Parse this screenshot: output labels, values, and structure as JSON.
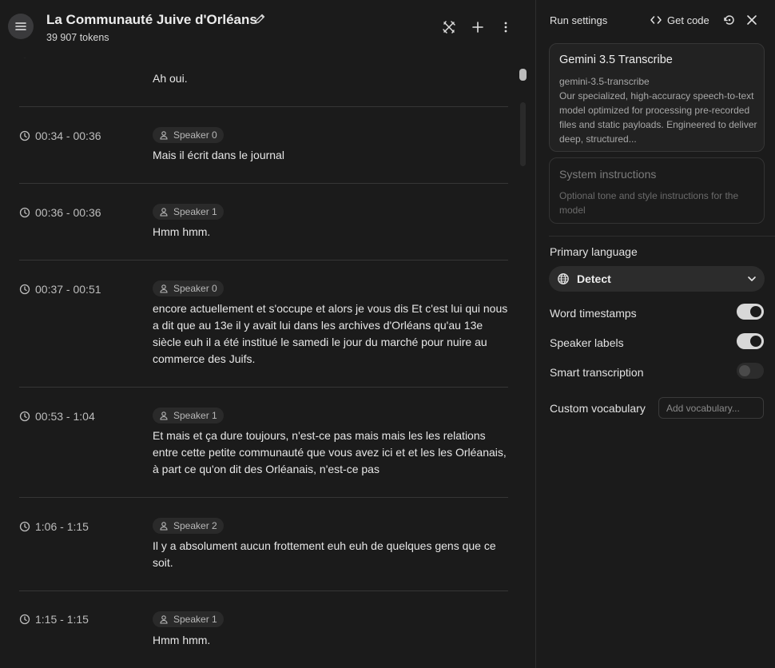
{
  "header": {
    "title": "La Communauté Juive d'Orléans",
    "tokens": "39 907 tokens"
  },
  "transcript": {
    "top_partial_text": "Ah oui.",
    "segments": [
      {
        "time": "00:34 - 00:36",
        "speaker": "Speaker 0",
        "text": "Mais il écrit dans le journal"
      },
      {
        "time": "00:36 - 00:36",
        "speaker": "Speaker 1",
        "text": "Hmm hmm."
      },
      {
        "time": "00:37 - 00:51",
        "speaker": "Speaker 0",
        "text": "encore actuellement et s'occupe et alors je vous dis Et c'est lui qui nous a dit que au 13e il y avait lui dans les archives d'Orléans qu'au 13e siècle euh il a été institué le samedi le jour du marché pour nuire au commerce des Juifs."
      },
      {
        "time": "00:53 - 1:04",
        "speaker": "Speaker 1",
        "text": "Et mais et ça dure toujours, n'est-ce pas mais mais les les relations entre cette petite communauté que vous avez ici et et les les Orléanais, à part ce qu'on dit des Orléanais, n'est-ce pas"
      },
      {
        "time": "1:06 - 1:15",
        "speaker": "Speaker 2",
        "text": "Il y a absolument aucun frottement euh euh de quelques gens que ce soit."
      },
      {
        "time": "1:15 - 1:15",
        "speaker": "Speaker 1",
        "text": "Hmm hmm."
      }
    ]
  },
  "run_settings": {
    "title": "Run settings",
    "get_code": "Get code",
    "model": {
      "name": "Gemini 3.5 Transcribe",
      "id": "gemini-3.5-transcribe",
      "description": "Our specialized, high-accuracy speech-to-text model optimized for processing pre-recorded files and static payloads. Engineered to deliver deep, structured..."
    },
    "system_instructions": {
      "title": "System instructions",
      "placeholder": "Optional tone and style instructions for the model"
    },
    "primary_language": {
      "label": "Primary language",
      "value": "Detect"
    },
    "word_timestamps": {
      "label": "Word timestamps",
      "enabled": true
    },
    "speaker_labels": {
      "label": "Speaker labels",
      "enabled": true
    },
    "smart_transcription": {
      "label": "Smart transcription",
      "enabled": false
    },
    "custom_vocabulary": {
      "label": "Custom vocabulary",
      "placeholder": "Add vocabulary..."
    }
  }
}
